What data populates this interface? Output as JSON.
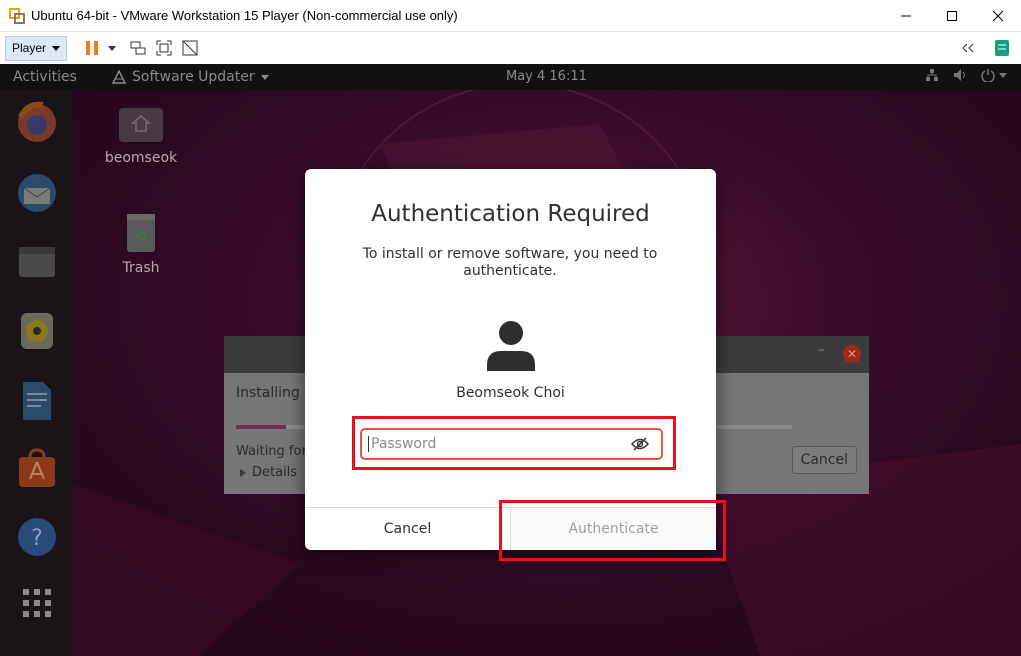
{
  "window": {
    "title": "Ubuntu 64-bit - VMware Workstation 15 Player (Non-commercial use only)"
  },
  "toolbar": {
    "player_label": "Player"
  },
  "ubuntu": {
    "activities": "Activities",
    "app_menu": "Software Updater",
    "clock": "May 4  16:11"
  },
  "desktop_icons": [
    {
      "label": "beomseok"
    },
    {
      "label": "Trash"
    }
  ],
  "updater": {
    "installing_text": "Installing u",
    "waiting_text": "Waiting for",
    "details_label": "Details",
    "cancel_label": "Cancel",
    "min_glyph": "–",
    "close_glyph": "✕"
  },
  "dialog": {
    "title": "Authentication Required",
    "message": "To install or remove software, you need to authenticate.",
    "user_name": "Beomseok Choi",
    "password_placeholder": "Password",
    "password_value": "",
    "cancel_label": "Cancel",
    "authenticate_label": "Authenticate"
  },
  "colors": {
    "highlight": "#e8101c",
    "focus_border": "#e9553f",
    "desktop_bg": "#2a0820"
  }
}
